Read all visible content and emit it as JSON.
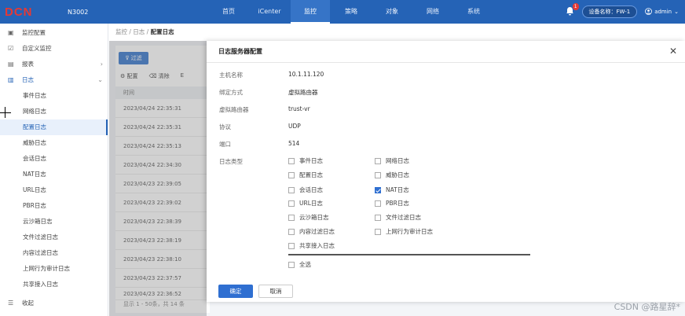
{
  "topbar": {
    "logo": "DCN",
    "model": "N3002",
    "nav": [
      "首页",
      "iCenter",
      "监控",
      "策略",
      "对象",
      "网络",
      "系统"
    ],
    "active_nav": "监控",
    "alert_count": "1",
    "device_label": "设备名称：FW-1",
    "user": "admin"
  },
  "sidebar": {
    "items": [
      {
        "label": "监控配置",
        "icon": "monitor-config-icon"
      },
      {
        "label": "自定义监控",
        "icon": "custom-monitor-icon"
      },
      {
        "label": "报表",
        "icon": "report-icon"
      },
      {
        "label": "日志",
        "icon": "log-icon"
      }
    ],
    "sub_items": [
      "事件日志",
      "网络日志",
      "配置日志",
      "威胁日志",
      "会话日志",
      "NAT日志",
      "URL日志",
      "PBR日志",
      "云沙箱日志",
      "文件过滤日志",
      "内容过滤日志",
      "上网行为审计日志",
      "共享接入日志"
    ],
    "active_sub": "配置日志",
    "collapse_label": "收起"
  },
  "breadcrumb": {
    "path": "监控 / 日志 / ",
    "current": "配置日志"
  },
  "background": {
    "filter_label": "过滤",
    "tools": [
      "配置",
      "清除",
      "E"
    ],
    "column_header": "时间",
    "rows": [
      "2023/04/24 22:35:31",
      "2023/04/24 22:35:31",
      "2023/04/24 22:35:13",
      "2023/04/24 22:34:30",
      "2023/04/23 22:39:05",
      "2023/04/23 22:39:02",
      "2023/04/23 22:38:39",
      "2023/04/23 22:38:19",
      "2023/04/23 22:38:10",
      "2023/04/23 22:37:57",
      "2023/04/23 22:36:52"
    ],
    "footer": "显示 1 - 50条，共 14 条"
  },
  "dialog": {
    "title": "日志服务器配置",
    "fields": [
      {
        "label": "主机名称",
        "value": "10.1.11.120"
      },
      {
        "label": "绑定方式",
        "value": "虚拟路由器"
      },
      {
        "label": "虚拟路由器",
        "value": "trust-vr"
      },
      {
        "label": "协议",
        "value": "UDP"
      },
      {
        "label": "端口",
        "value": "514"
      }
    ],
    "log_type_label": "日志类型",
    "log_types_left": [
      {
        "label": "事件日志",
        "checked": false
      },
      {
        "label": "配置日志",
        "checked": false
      },
      {
        "label": "会话日志",
        "checked": false
      },
      {
        "label": "URL日志",
        "checked": false
      },
      {
        "label": "云沙箱日志",
        "checked": false
      },
      {
        "label": "内容过滤日志",
        "checked": false
      },
      {
        "label": "共享接入日志",
        "checked": false
      }
    ],
    "log_types_right": [
      {
        "label": "网络日志",
        "checked": false
      },
      {
        "label": "威胁日志",
        "checked": false
      },
      {
        "label": "NAT日志",
        "checked": true
      },
      {
        "label": "PBR日志",
        "checked": false
      },
      {
        "label": "文件过滤日志",
        "checked": false
      },
      {
        "label": "上网行为审计日志",
        "checked": false
      }
    ],
    "select_all_label": "全选",
    "ok_label": "确定",
    "cancel_label": "取消"
  },
  "watermark": "CSDN @路星辞*"
}
